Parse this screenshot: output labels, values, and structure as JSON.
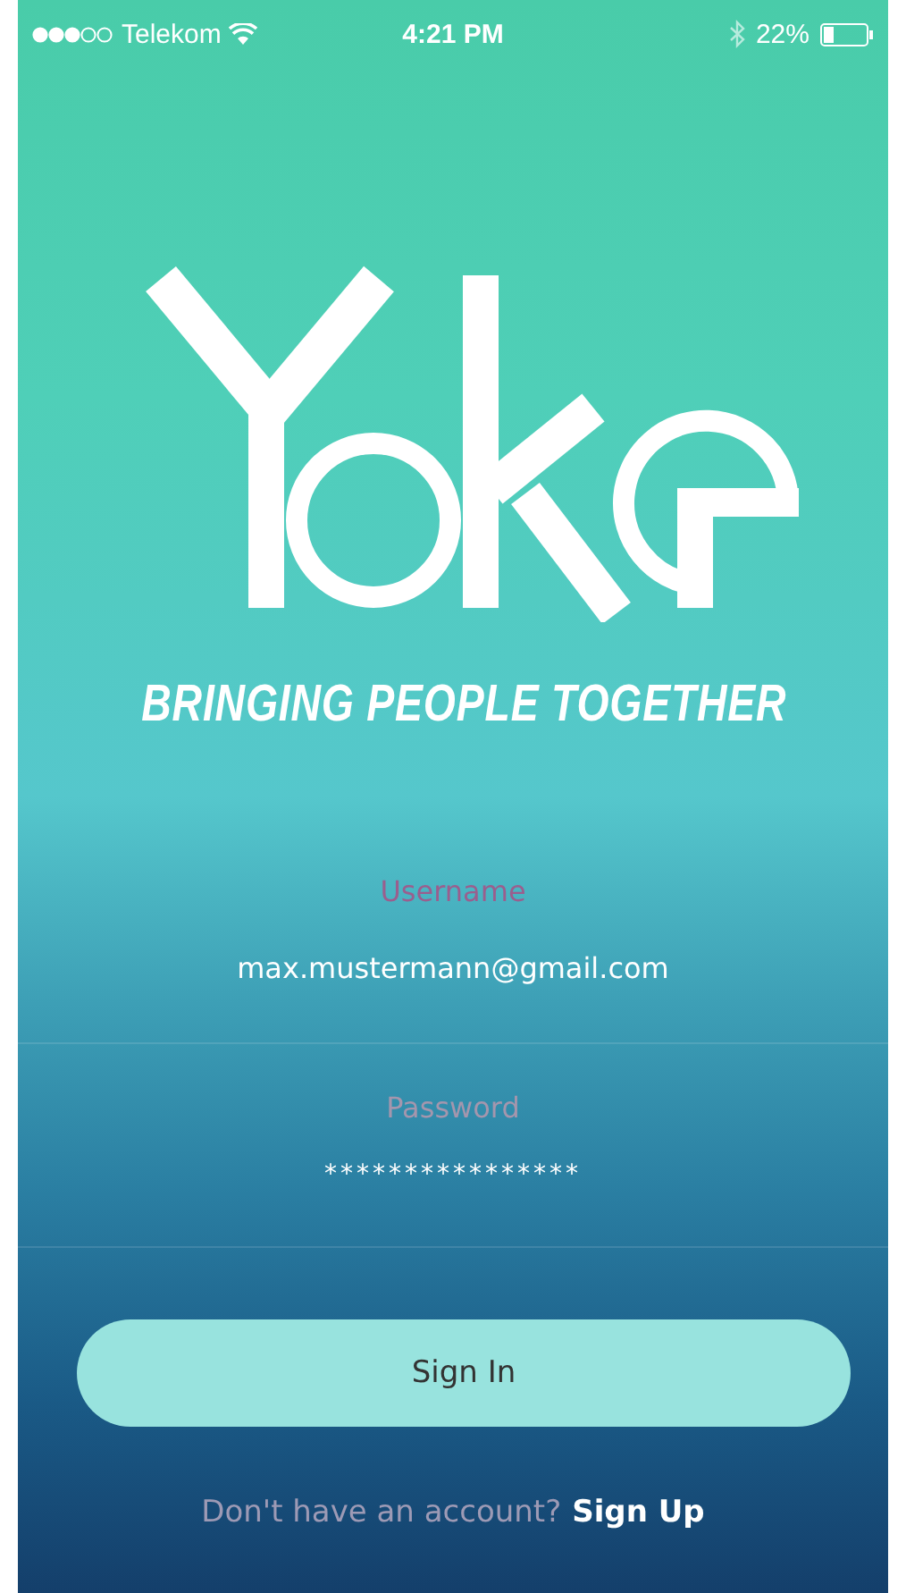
{
  "status_bar": {
    "carrier": "Telekom",
    "time": "4:21 PM",
    "battery": "22%"
  },
  "tagline": "BRINGING PEOPLE TOGETHER",
  "fields": [
    {
      "kind": "text",
      "label": "Username",
      "value": "max.mustermann@gmail.com"
    },
    {
      "kind": "password",
      "label": "Password",
      "value": "****************"
    }
  ],
  "sign_in_button": "Sign In",
  "footer": {
    "prompt": "Don't have an account?",
    "link": "Sign Up"
  }
}
